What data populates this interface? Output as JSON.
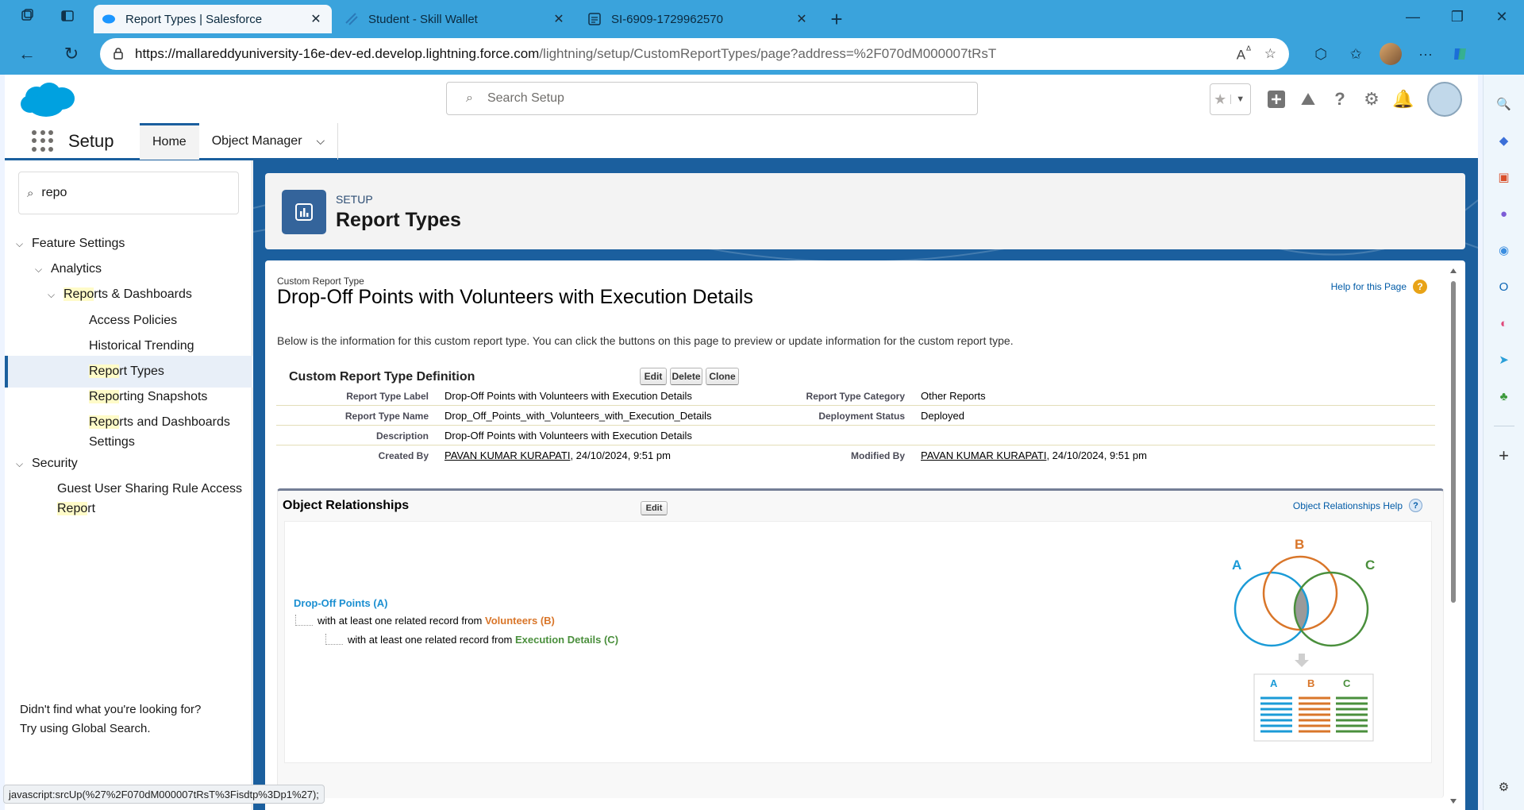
{
  "browser": {
    "tabs": [
      {
        "label": "Report Types | Salesforce",
        "active": true
      },
      {
        "label": "Student - Skill Wallet",
        "active": false
      },
      {
        "label": "SI-6909-1729962570",
        "active": false
      }
    ],
    "url_host": "https://mallareddyuniversity-16e-dev-ed.develop.lightning.force.com",
    "url_path": "/lightning/setup/CustomReportTypes/page?address=%2F070dM000007tRsT",
    "status_text": "javascript:srcUp(%27%2F070dM000007tRsT%3Fisdtp%3Dp1%27);"
  },
  "header": {
    "search_placeholder": "Search Setup"
  },
  "context": {
    "app_name": "Setup",
    "tabs": [
      "Home",
      "Object Manager"
    ]
  },
  "setup_tree": {
    "quick_find_value": "repo",
    "items": [
      {
        "pre": "",
        "hl": "",
        "post": "Feature Settings"
      },
      {
        "pre": "",
        "hl": "",
        "post": "Analytics"
      },
      {
        "pre": "",
        "hl": "Repo",
        "post": "rts & Dashboards"
      },
      {
        "pre": "",
        "hl": "",
        "post": "Access Policies"
      },
      {
        "pre": "",
        "hl": "",
        "post": "Historical Trending"
      },
      {
        "pre": "",
        "hl": "Repo",
        "post": "rt Types"
      },
      {
        "pre": "",
        "hl": "Repo",
        "post": "rting Snapshots"
      },
      {
        "pre": "",
        "hl": "Repo",
        "post": "rts and Dashboards"
      },
      {
        "pre": "",
        "hl": "",
        "post": "Settings"
      },
      {
        "pre": "",
        "hl": "",
        "post": "Security"
      },
      {
        "pre": "",
        "hl": "",
        "post": "Guest User Sharing Rule Access"
      },
      {
        "pre": "",
        "hl": "Repo",
        "post": "rt"
      }
    ],
    "no_result_line1": "Didn't find what you're looking for?",
    "no_result_line2": "Try using Global Search."
  },
  "page_header": {
    "eyebrow": "SETUP",
    "title": "Report Types"
  },
  "detail": {
    "subtitle": "Custom Report Type",
    "title": "Drop-Off Points with Volunteers with Execution Details",
    "help_link": "Help for this Page",
    "intro": "Below is the information for this custom report type. You can click the buttons on this page to preview or update information for the custom report type.",
    "section_title": "Custom Report Type Definition",
    "buttons": {
      "edit": "Edit",
      "delete": "Delete",
      "clone": "Clone"
    },
    "fields": {
      "report_type_label": {
        "label": "Report Type Label",
        "value": "Drop-Off Points with Volunteers with Execution Details"
      },
      "report_type_name": {
        "label": "Report Type Name",
        "value": "Drop_Off_Points_with_Volunteers_with_Execution_Details"
      },
      "description": {
        "label": "Description",
        "value": "Drop-Off Points with Volunteers with Execution Details"
      },
      "created_by": {
        "label": "Created By",
        "user": "PAVAN KUMAR KURAPATI",
        "date": ", 24/10/2024, 9:51 pm"
      },
      "report_type_category": {
        "label": "Report Type Category",
        "value": "Other Reports"
      },
      "deployment_status": {
        "label": "Deployment Status",
        "value": "Deployed"
      },
      "modified_by": {
        "label": "Modified By",
        "user": "PAVAN KUMAR KURAPATI",
        "date": ", 24/10/2024, 9:51 pm"
      }
    }
  },
  "relationships": {
    "title": "Object Relationships",
    "edit": "Edit",
    "help": "Object Relationships Help",
    "primary": "Drop-Off Points (A)",
    "line1_prefix": "with at least one related record from ",
    "line1_object": "Volunteers (B)",
    "line2_prefix": "with at least one related record from ",
    "line2_object": "Execution Details (C)",
    "venn_labels": [
      "A",
      "B",
      "C"
    ],
    "colors": {
      "A": "#1b9bd7",
      "B": "#d9762a",
      "C": "#4a8f3c"
    }
  }
}
